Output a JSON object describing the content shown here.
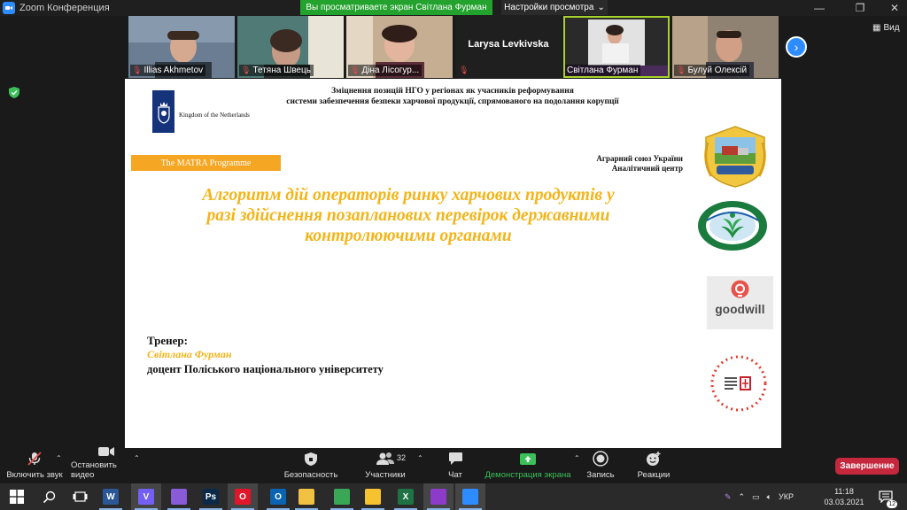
{
  "titlebar": {
    "title": "Zoom Конференция",
    "share_banner": "Вы просматриваете экран Світлана Фурман",
    "view_settings": "Настройки просмотра"
  },
  "gallery": {
    "participants": [
      {
        "name": "Illias Akhmetov",
        "muted": true,
        "color": "#6a7d92"
      },
      {
        "name": "Тетяна Швець",
        "muted": true,
        "color": "#4f7a76"
      },
      {
        "name": "Діна Лісогур...",
        "muted": true,
        "color": "#b59b81"
      },
      {
        "name": "Larysa Levkivska",
        "muted": true,
        "color": "#1f1f1f"
      },
      {
        "name": "Світлана Фурман",
        "muted": false,
        "color": "#d8d8d8",
        "active": true
      },
      {
        "name": "Булуй Олексій",
        "muted": true,
        "color": "#8f8272"
      }
    ],
    "view_label": "Вид"
  },
  "slide": {
    "nl_label": "Kingdom of the Netherlands",
    "header_line1": "Зміцнення позицій НГО у регіонах як учасників реформування",
    "header_line2": "системи забезпечення безпеки харчової продукції, спрямованого на подолання корупції",
    "matra": "The MATRA Programme",
    "union_line1": "Аграрний союз України",
    "union_line2": "Аналітичний центр",
    "title_line1": "Алгоритм дій операторів ринку харчових продуктів у",
    "title_line2": "разі здійснення позапланових перевірок державними",
    "title_line3": "контролюючими органами",
    "trainer_label": "Тренер:",
    "trainer_name": "Світлана  Фурман",
    "trainer_position": "доцент Поліського національного університету",
    "goodwill_text": "goodwill"
  },
  "controls": {
    "mute_label": "Включить звук",
    "video_label": "Остановить видео",
    "security_label": "Безопасность",
    "participants_label": "Участники",
    "participants_count": "32",
    "chat_label": "Чат",
    "share_label": "Демонстрация экрана",
    "record_label": "Запись",
    "reactions_label": "Реакции",
    "end_label": "Завершение"
  },
  "taskbar": {
    "apps": [
      {
        "name": "word-app",
        "letter": "W",
        "color": "#2b5797"
      },
      {
        "name": "viber-app",
        "letter": "V",
        "color": "#7360f2"
      },
      {
        "name": "feather-app",
        "letter": "",
        "color": "#8a5bd6"
      },
      {
        "name": "photoshop-app",
        "letter": "Ps",
        "color": "#0b2a4a"
      },
      {
        "name": "opera-app",
        "letter": "O",
        "color": "#e1162a"
      },
      {
        "name": "outlook-app",
        "letter": "O",
        "color": "#0a64b2"
      },
      {
        "name": "explorer-app",
        "letter": "",
        "color": "#f1c143"
      },
      {
        "name": "chrome-app",
        "letter": "",
        "color": "#3aa757"
      },
      {
        "name": "sticky-notes-app",
        "letter": "",
        "color": "#f6c22f"
      },
      {
        "name": "excel-app",
        "letter": "X",
        "color": "#1f7244"
      },
      {
        "name": "pdf-app",
        "letter": "",
        "color": "#8c3cc8"
      },
      {
        "name": "zoom-app",
        "letter": "",
        "color": "#2d8cff"
      }
    ],
    "lang": "УКР",
    "time": "11:18",
    "date": "03.03.2021",
    "notif_count": "12"
  }
}
